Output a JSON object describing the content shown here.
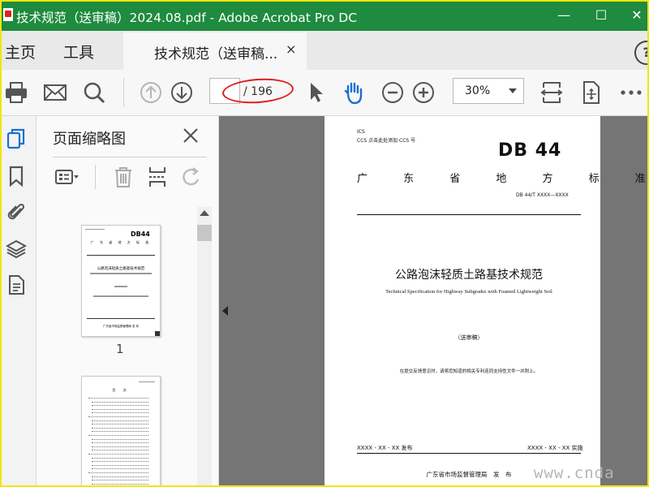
{
  "window": {
    "title": "技术规范（送审稿）2024.08.pdf - Adobe Acrobat Pro DC",
    "controls": {
      "minimize": "—",
      "maximize": "☐",
      "close": "✕"
    }
  },
  "tabs": {
    "home": "主页",
    "tools": "工具",
    "document": "技术规范（送审稿...",
    "document_close": "×",
    "help": "?"
  },
  "toolbar": {
    "page_current": "",
    "page_total": "/ 196",
    "zoom": "30%",
    "icons": [
      "print-icon",
      "email-icon",
      "search-icon",
      "page-up-icon",
      "page-down-icon",
      "select-cursor-icon",
      "hand-tool-icon",
      "zoom-out-icon",
      "zoom-in-icon",
      "fit-page-icon",
      "scroll-mode-icon",
      "more-icon"
    ]
  },
  "rail": {
    "icons": [
      "page-thumbnails-icon",
      "bookmarks-icon",
      "attachments-icon",
      "layers-icon",
      "content-icon"
    ]
  },
  "panel": {
    "title": "页面缩略图",
    "close": "×",
    "thumb_label": "1",
    "thumb1": {
      "logo": "DB44",
      "header": "广 东 省 地 方 标 准",
      "title": "公路泡沫轻质土路基技术规范",
      "footer": "广东省市场监督管理局 发 布"
    },
    "thumb2": {
      "heading": "目 次"
    }
  },
  "document_page": {
    "ics": "ICS",
    "ccs": "CCS 点击此处添加 CCS 号",
    "logo": "DB 44",
    "header": "广 东 省 地 方 标 准",
    "standard_number": "DB 44/T XXXX—XXXX",
    "title_cn": "公路泡沫轻质土路基技术规范",
    "title_en": "Technical Specification for Highway Subgrades with Foamed Lightweight Soil",
    "draft_status": "（送审稿）",
    "note": "在提交反馈意见时，请将您知道的相关专利连同支持性文件一并附上。",
    "issue_date": "XXXX - XX - XX 发布",
    "impl_date": "XXXX - XX - XX 实施",
    "issuer": "广东省市场监督管理局　发　布"
  },
  "overlay": {
    "watermark": "www.cnda"
  },
  "colors": {
    "title_bar": "#1e8b3e",
    "annotation_ring": "#e21c1c",
    "active_icon": "#1a6fd0",
    "frame_border": "#f0e60a"
  }
}
